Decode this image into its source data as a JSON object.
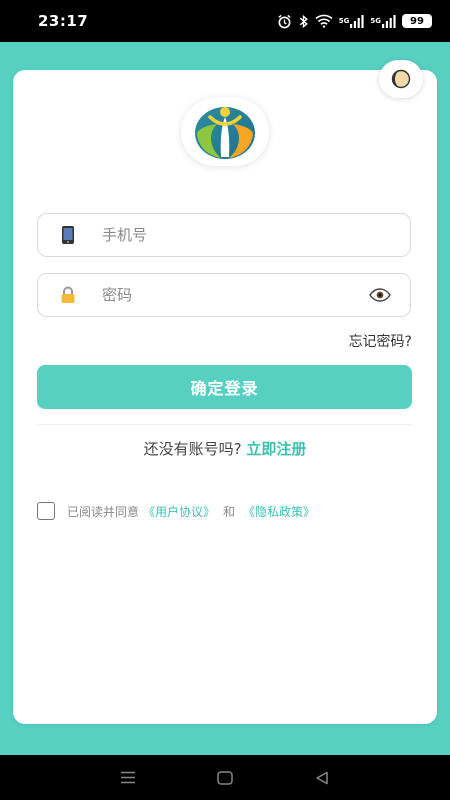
{
  "status_bar": {
    "time": "23:17",
    "signal1": "5G",
    "signal2": "5G",
    "battery": "99",
    "icons": [
      "alarm-icon",
      "bluetooth-icon",
      "wifi-icon",
      "signal-icon",
      "signal-icon",
      "battery-icon"
    ]
  },
  "login": {
    "phone_placeholder": "手机号",
    "password_placeholder": "密码",
    "forgot_password": "忘记密码?",
    "submit_label": "确定登录",
    "no_account_text": "还没有账号吗?",
    "register_link": "立即注册"
  },
  "agreement": {
    "prefix": "已阅读并同意",
    "user_agreement": "《用户协议》",
    "and": "和",
    "privacy_policy": "《隐私政策》"
  },
  "colors": {
    "brand": "#57cfc1",
    "link": "#3fbfb0",
    "status_bar": "#000000"
  },
  "icons": {
    "phone": "mobile-phone-icon",
    "password": "lock-icon",
    "visibility": "eye-icon",
    "theme": "theme-toggle-icon",
    "logo": "app-logo"
  }
}
